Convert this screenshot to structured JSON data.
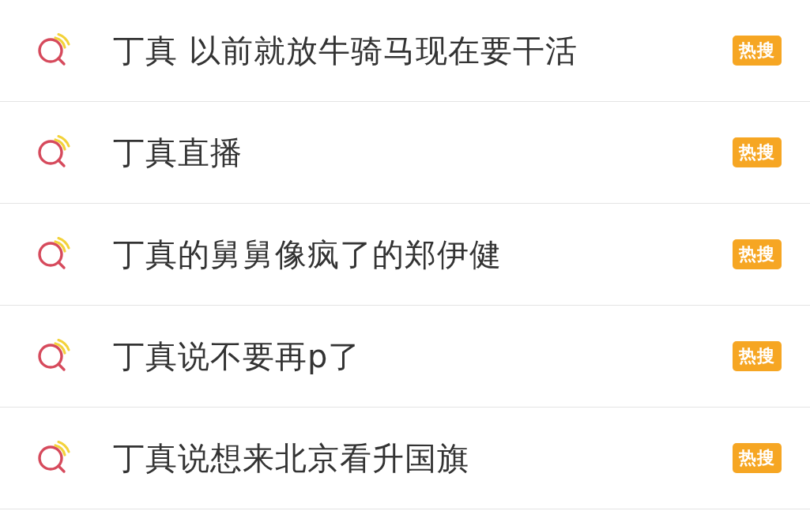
{
  "search_suggestions": [
    {
      "text": "丁真 以前就放牛骑马现在要干活",
      "badge": "热搜"
    },
    {
      "text": "丁真直播",
      "badge": "热搜"
    },
    {
      "text": "丁真的舅舅像疯了的郑伊健",
      "badge": "热搜"
    },
    {
      "text": "丁真说不要再p了",
      "badge": "热搜"
    },
    {
      "text": "丁真说想来北京看升国旗",
      "badge": "热搜"
    }
  ]
}
